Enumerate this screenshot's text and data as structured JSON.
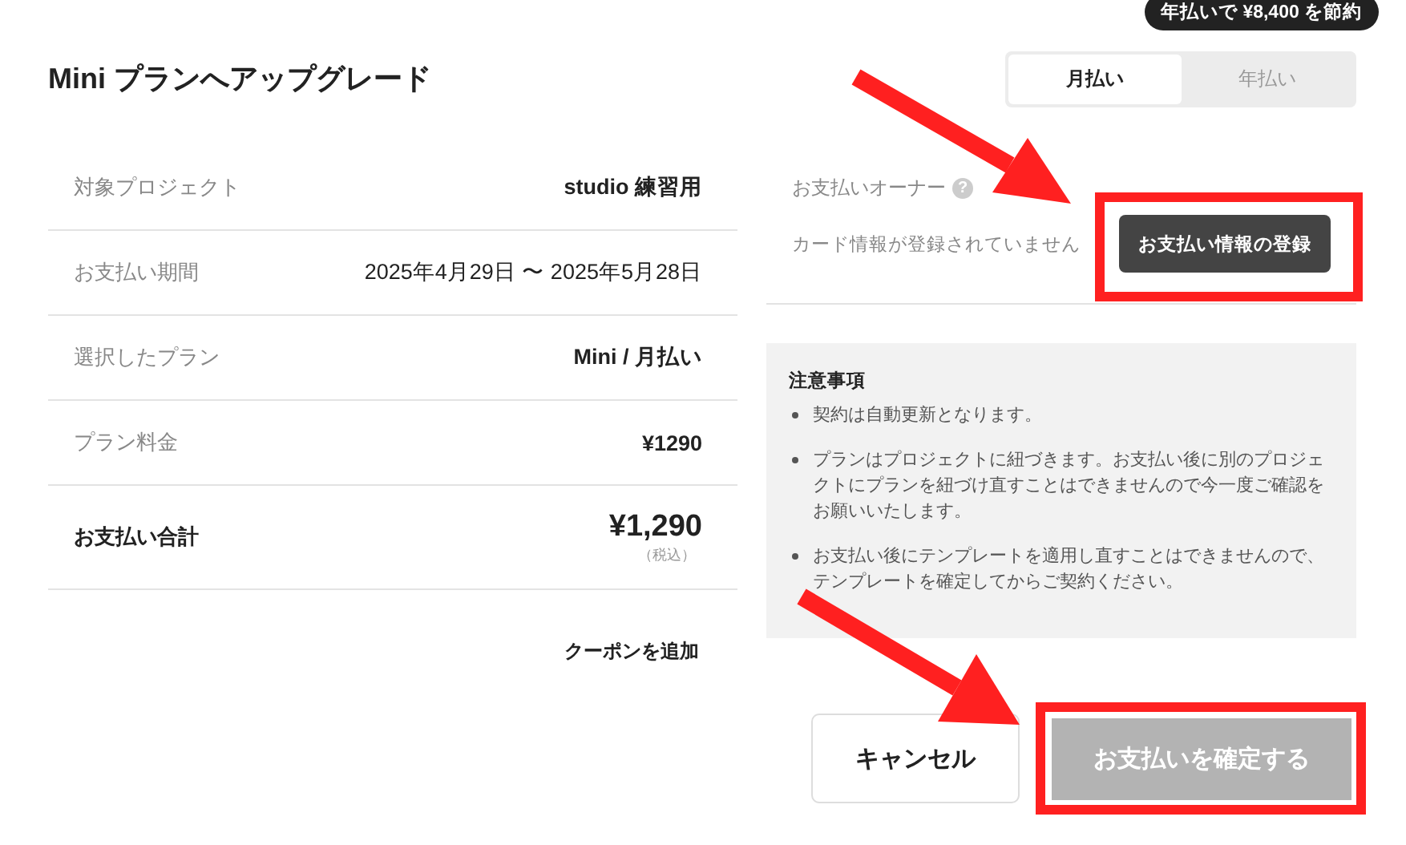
{
  "title": "Mini プランへアップグレード",
  "savings_badge": "年払いで ¥8,400 を節約",
  "billing_toggle": [
    {
      "label": "月払い",
      "selected": true
    },
    {
      "label": "年払い",
      "selected": false
    }
  ],
  "summary": [
    {
      "kind": "item",
      "label": "対象プロジェクト",
      "value": "studio 練習用"
    },
    {
      "kind": "item",
      "label": "お支払い期間",
      "value": "2025年4月29日 〜 2025年5月28日"
    },
    {
      "kind": "item",
      "label": "選択したプラン",
      "value": "Mini / 月払い"
    },
    {
      "kind": "item",
      "label": "プラン料金",
      "value": "¥1290"
    },
    {
      "kind": "total",
      "label": "お支払い合計",
      "value": "¥1,290",
      "note": "（税込）"
    }
  ],
  "coupon_link": "クーポンを追加",
  "owner": {
    "label": "お支払いオーナー",
    "help": "?",
    "status": "カード情報が登録されていません",
    "button": "お支払い情報の登録"
  },
  "notes": {
    "title": "注意事項",
    "items": [
      "契約は自動更新となります。",
      "プランはプロジェクトに紐づきます。お支払い後に別のプロジェクトにプランを紐づけ直すことはできませんので今一度ご確認をお願いいたします。",
      "お支払い後にテンプレートを適用し直すことはできませんので、テンプレートを確定してからご契約ください。"
    ]
  },
  "actions": {
    "cancel": "キャンセル",
    "confirm": {
      "label": "お支払いを確定する",
      "disabled": true
    }
  }
}
